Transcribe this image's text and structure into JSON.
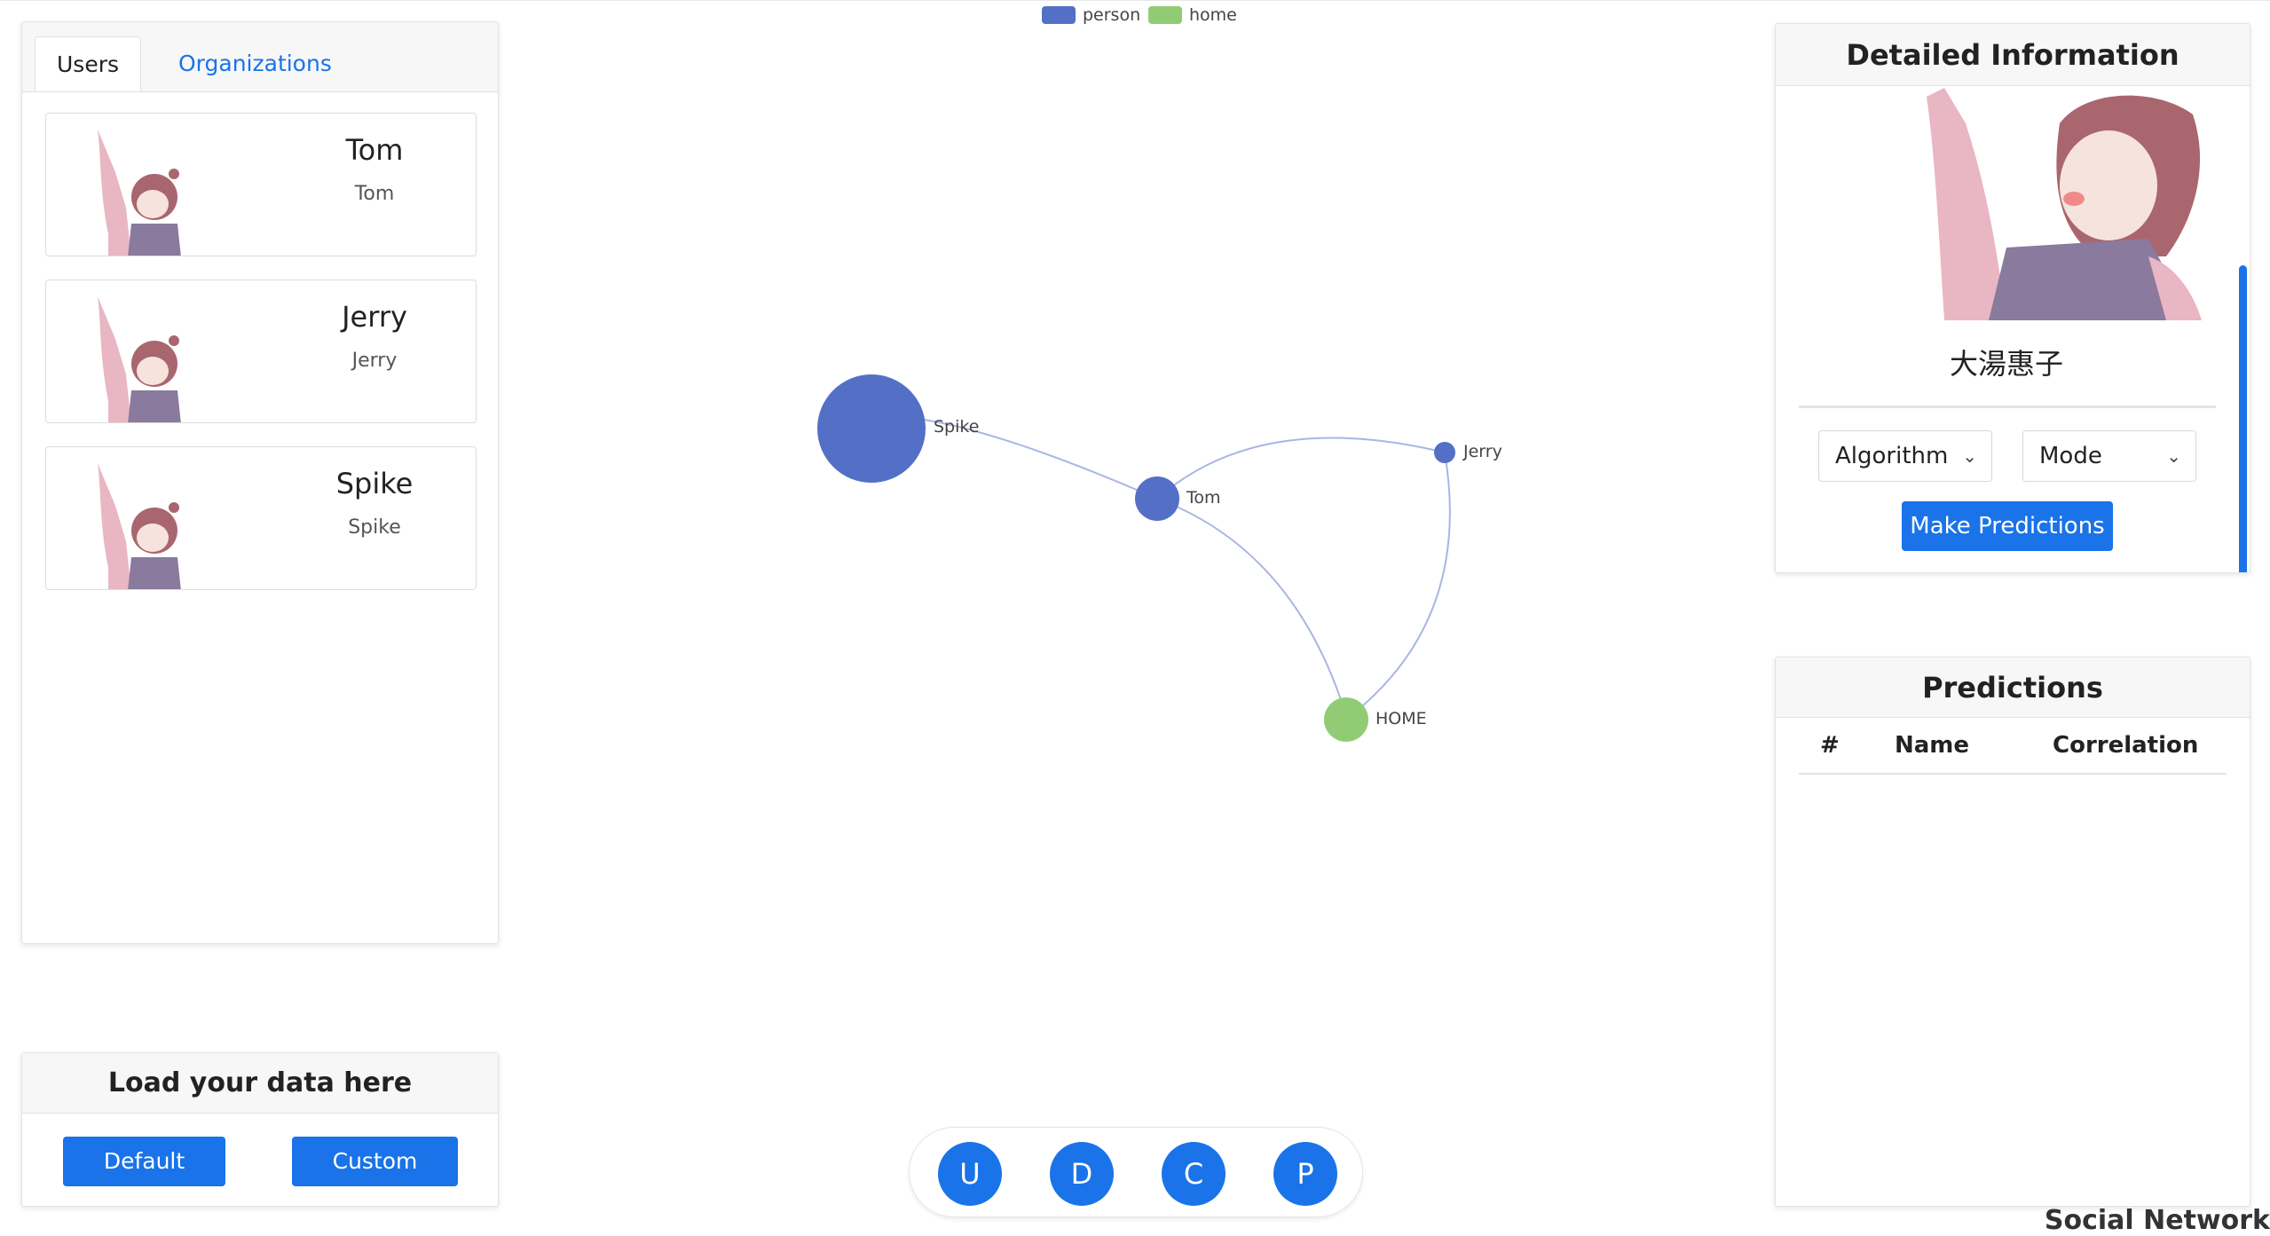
{
  "tabs": [
    {
      "label": "Users"
    },
    {
      "label": "Organizations"
    }
  ],
  "users": [
    {
      "name": "Tom",
      "subtitle": "Tom"
    },
    {
      "name": "Jerry",
      "subtitle": "Jerry"
    },
    {
      "name": "Spike",
      "subtitle": "Spike"
    }
  ],
  "load_panel": {
    "title": "Load your data here",
    "default_label": "Default",
    "custom_label": "Custom"
  },
  "graph": {
    "legend": [
      {
        "label": "person",
        "color": "#5470c6"
      },
      {
        "label": "home",
        "color": "#91cc75"
      }
    ],
    "nodes": [
      {
        "label": "Spike",
        "category": "person"
      },
      {
        "label": "Tom",
        "category": "person"
      },
      {
        "label": "Jerry",
        "category": "person"
      },
      {
        "label": "HOME",
        "category": "home"
      }
    ]
  },
  "toolbar": {
    "buttons": [
      "U",
      "D",
      "C",
      "P"
    ]
  },
  "detail": {
    "title": "Detailed Information",
    "name": "大湯惠子",
    "algorithm_label": "Algorithm",
    "mode_label": "Mode",
    "predict_label": "Make Predictions"
  },
  "predictions": {
    "title": "Predictions",
    "columns": [
      "#",
      "Name",
      "Correlation"
    ]
  },
  "brand": "Social Network",
  "colors": {
    "accent": "#1a73e8",
    "person": "#5470c6",
    "home": "#91cc75"
  }
}
